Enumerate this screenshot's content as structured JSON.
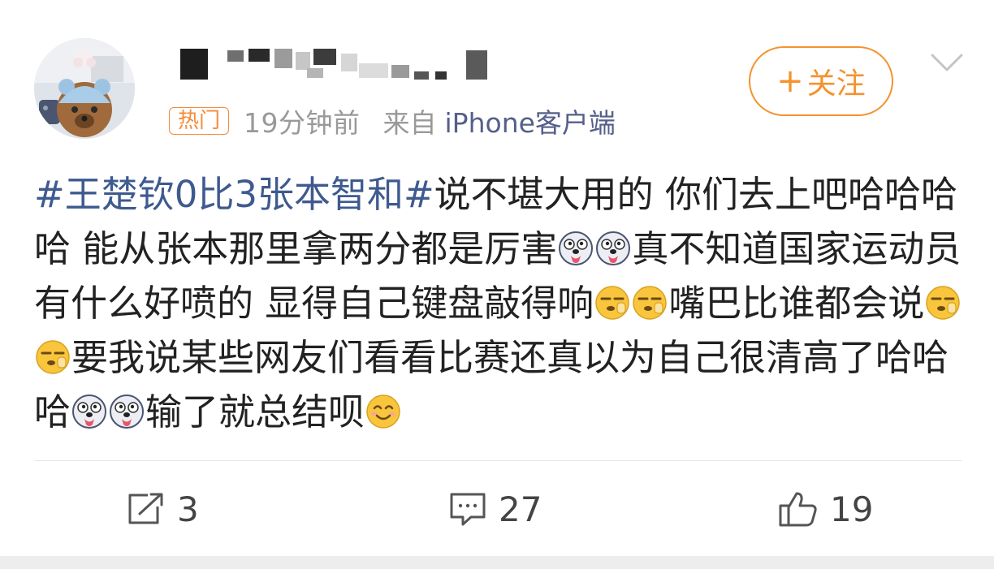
{
  "post": {
    "meta": {
      "tag": "热门",
      "time": "19分钟前",
      "from_label": "来自",
      "client": "iPhone客户端"
    },
    "follow_button": {
      "plus": "+",
      "label": "关注"
    },
    "content": {
      "hashtag": "#王楚钦0比3张本智和#",
      "segments": [
        "说不堪大用的 你们去上吧哈哈哈哈 能从张本那里拿两分都是厉害",
        "真不知道国家运动员有什么好喷的 显得自己键盘敲得响",
        "嘴巴比谁都会说",
        "要我说某些网友们看看比赛还真以为自己很清高了哈哈哈",
        "输了就总结呗"
      ],
      "emojis": [
        "husky",
        "husky",
        "yawn",
        "yawn",
        "yawn",
        "yawn",
        "husky",
        "husky",
        "smile"
      ]
    },
    "actions": {
      "repost_count": "3",
      "comment_count": "27",
      "like_count": "19"
    }
  },
  "colors": {
    "accent": "#f5922e",
    "hashtag": "#3e5a8f",
    "client": "#555f8a",
    "meta": "#999999"
  }
}
